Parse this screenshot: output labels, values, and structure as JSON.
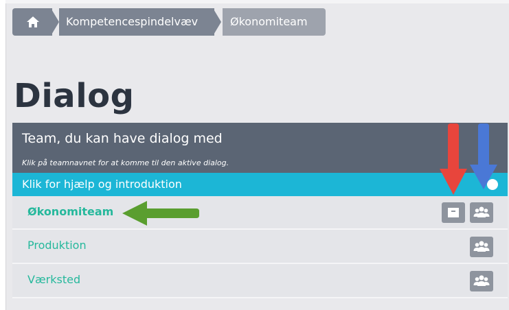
{
  "breadcrumb": {
    "items": [
      "Kompetencespindelvæv",
      "Økonomiteam"
    ]
  },
  "page": {
    "title": "Dialog"
  },
  "panel": {
    "title": "Team, du kan have dialog med",
    "subtitle": "Klik på teamnavnet for at komme til den aktive dialog.",
    "help_label": "Klik for hjælp og introduktion"
  },
  "teams": [
    {
      "name": "Økonomiteam"
    },
    {
      "name": "Produktion"
    },
    {
      "name": "Værksted"
    }
  ],
  "icons": {
    "home": "home-icon",
    "archive": "archive-icon",
    "team": "users-icon",
    "info": "info-icon"
  },
  "colors": {
    "header": "#5b6574",
    "help_bar": "#1cb6d6",
    "link": "#26b89c",
    "red_arrow": "#e8453c",
    "blue_arrow": "#4a78d6",
    "green_arrow": "#5a9e2f"
  }
}
